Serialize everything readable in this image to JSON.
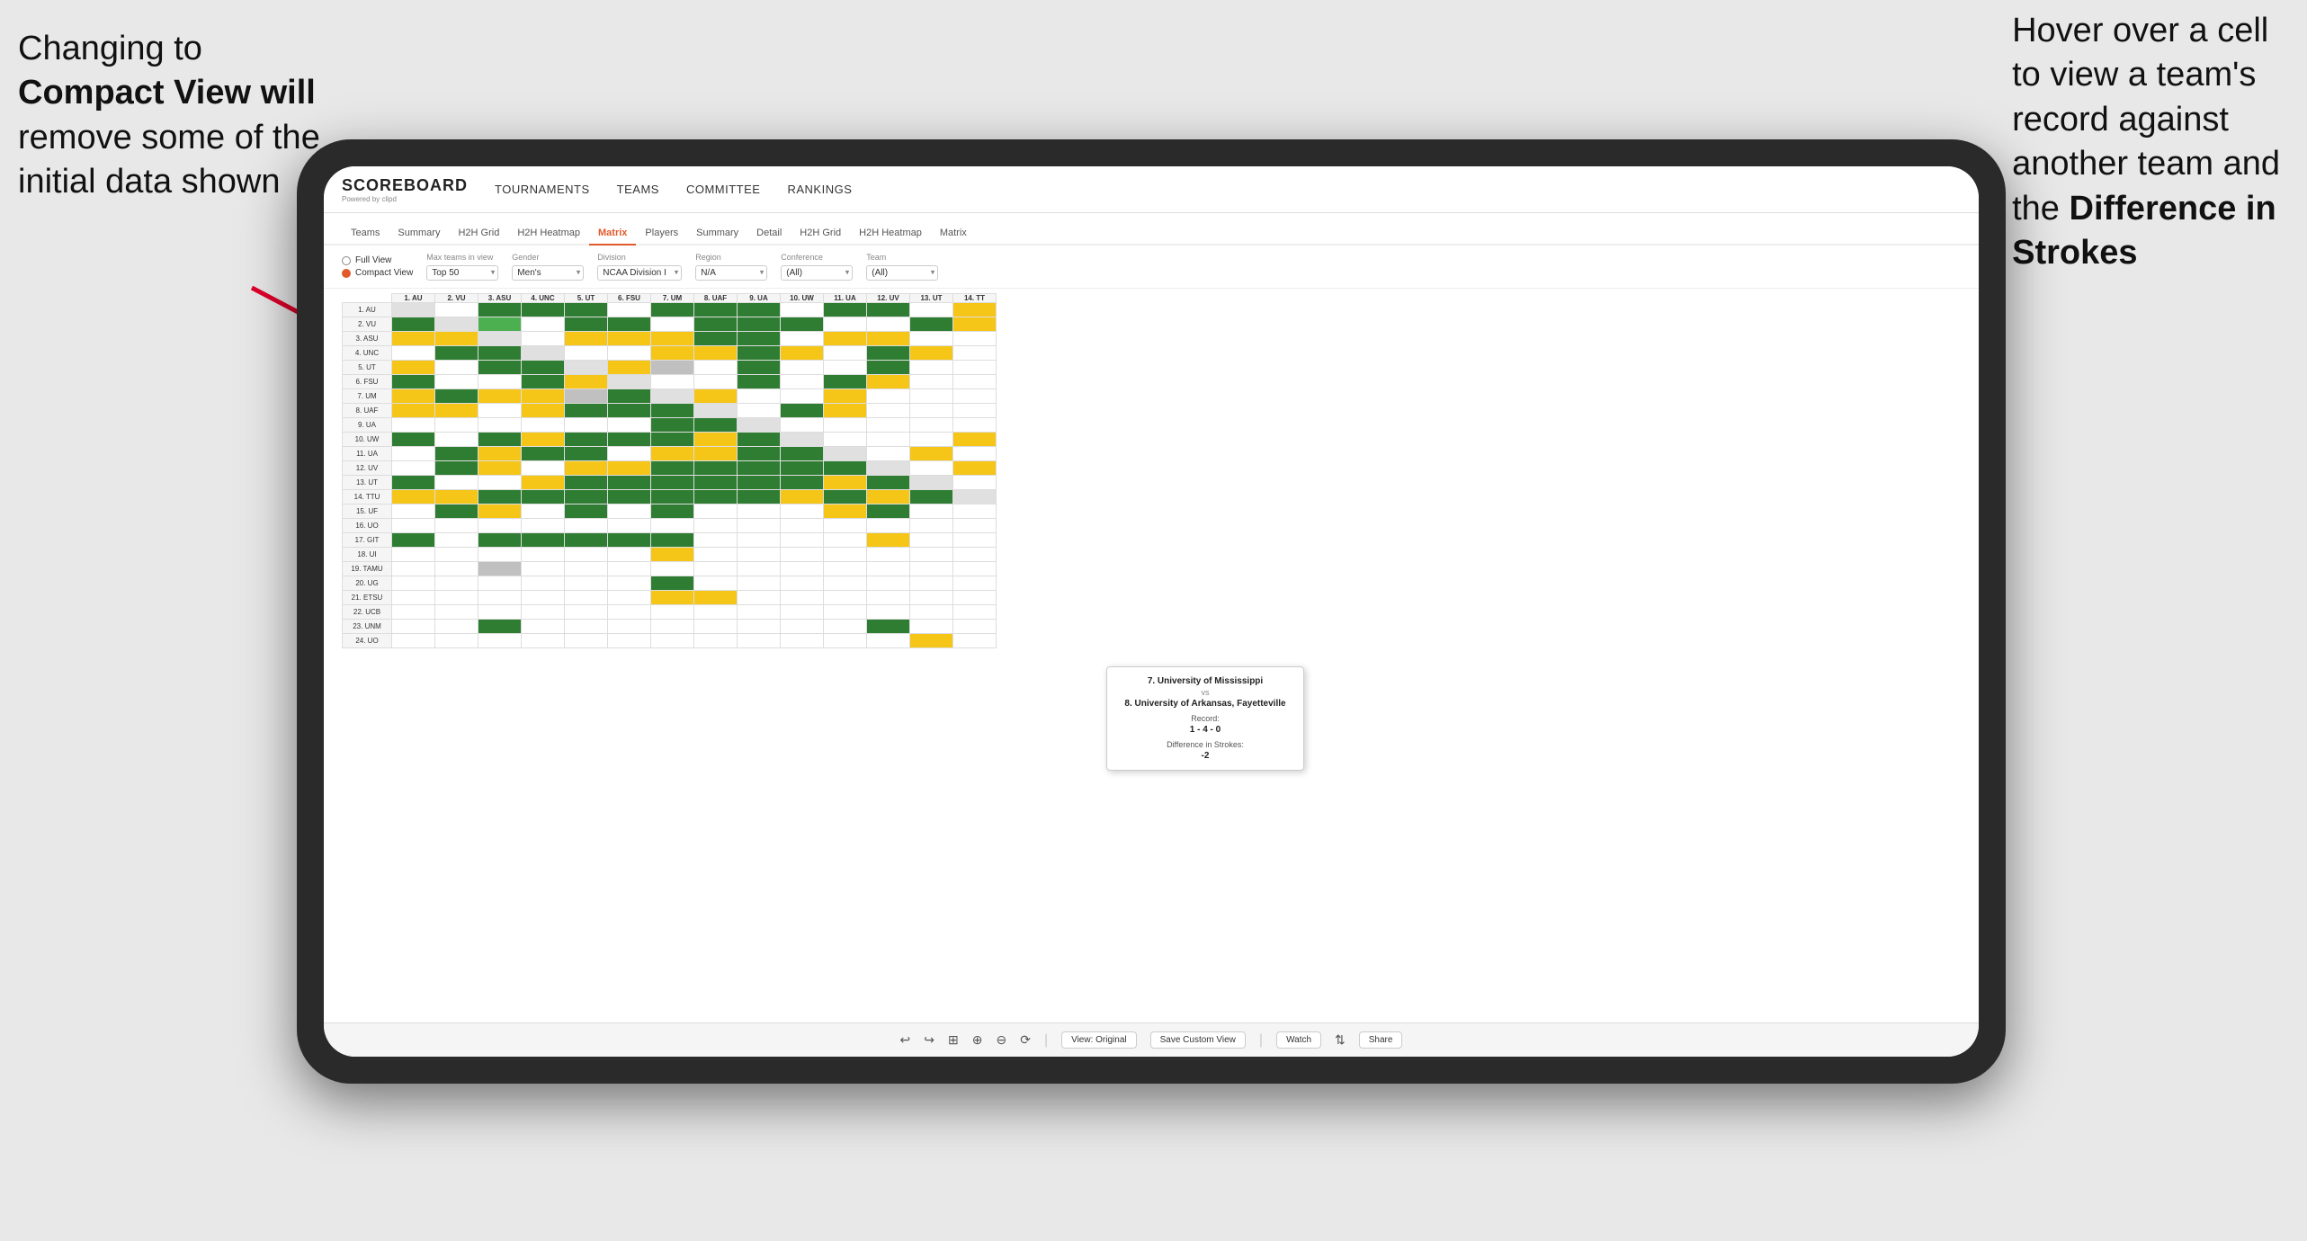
{
  "annotations": {
    "left": {
      "line1": "Changing to",
      "line2": "Compact View will",
      "line3": "remove some of the",
      "line4": "initial data shown"
    },
    "right": {
      "line1": "Hover over a cell",
      "line2": "to view a team's",
      "line3": "record against",
      "line4": "another team and",
      "line5": "the ",
      "line5bold": "Difference in",
      "line6": "Strokes"
    }
  },
  "app": {
    "logo": "SCOREBOARD",
    "logo_sub": "Powered by clipd",
    "nav": [
      "TOURNAMENTS",
      "TEAMS",
      "COMMITTEE",
      "RANKINGS"
    ],
    "sub_tabs": [
      {
        "label": "Teams",
        "active": false
      },
      {
        "label": "Summary",
        "active": false
      },
      {
        "label": "H2H Grid",
        "active": false
      },
      {
        "label": "H2H Heatmap",
        "active": false
      },
      {
        "label": "Matrix",
        "active": true
      },
      {
        "label": "Players",
        "active": false
      },
      {
        "label": "Summary",
        "active": false
      },
      {
        "label": "Detail",
        "active": false
      },
      {
        "label": "H2H Grid",
        "active": false
      },
      {
        "label": "H2H Heatmap",
        "active": false
      },
      {
        "label": "Matrix",
        "active": false
      }
    ],
    "view_options": {
      "full_view": "Full View",
      "compact_view": "Compact View",
      "selected": "compact"
    },
    "filters": {
      "max_teams": {
        "label": "Max teams in view",
        "value": "Top 50"
      },
      "gender": {
        "label": "Gender",
        "value": "Men's"
      },
      "division": {
        "label": "Division",
        "value": "NCAA Division I"
      },
      "region": {
        "label": "Region",
        "value": "N/A"
      },
      "conference": {
        "label": "Conference",
        "value": "(All)"
      },
      "team": {
        "label": "Team",
        "value": "(All)"
      }
    },
    "col_headers": [
      "1. AU",
      "2. VU",
      "3. ASU",
      "4. UNC",
      "5. UT",
      "6. FSU",
      "7. UM",
      "8. UAF",
      "9. UA",
      "10. UW",
      "11. UA",
      "12. UV",
      "13. UT",
      "14. TT"
    ],
    "row_teams": [
      "1. AU",
      "2. VU",
      "3. ASU",
      "4. UNC",
      "5. UT",
      "6. FSU",
      "7. UM",
      "8. UAF",
      "9. UA",
      "10. UW",
      "11. UA",
      "12. UV",
      "13. UT",
      "14. TTU",
      "15. UF",
      "16. UO",
      "17. GIT",
      "18. UI",
      "19. TAMU",
      "20. UG",
      "21. ETSU",
      "22. UCB",
      "23. UNM",
      "24. UO"
    ],
    "tooltip": {
      "team1": "7. University of Mississippi",
      "vs": "vs",
      "team2": "8. University of Arkansas, Fayetteville",
      "record_label": "Record:",
      "record_value": "1 - 4 - 0",
      "strokes_label": "Difference in Strokes:",
      "strokes_value": "-2"
    },
    "toolbar": {
      "view_original": "View: Original",
      "save_custom": "Save Custom View",
      "watch": "Watch",
      "share": "Share"
    }
  }
}
